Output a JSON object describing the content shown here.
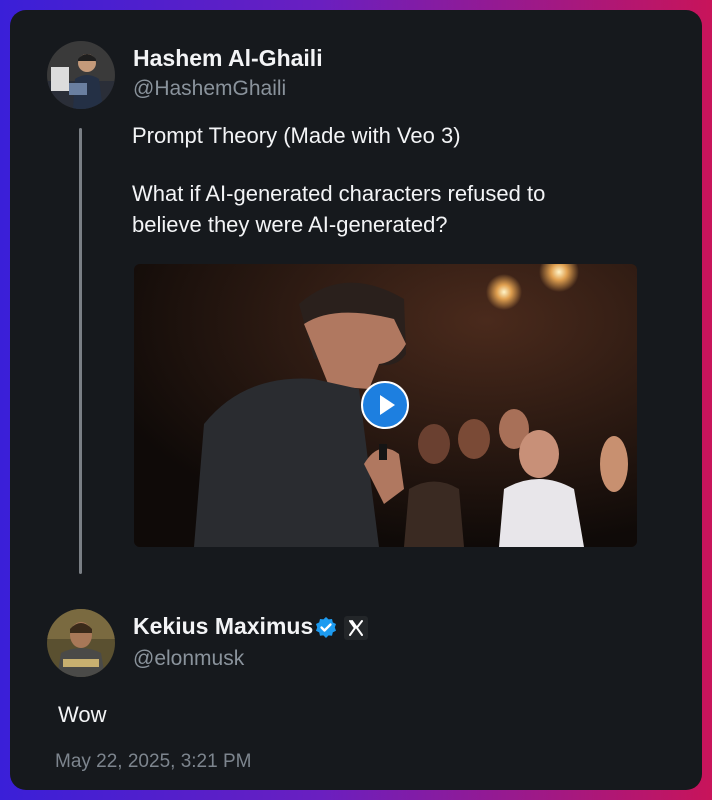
{
  "original_post": {
    "author_name": "Hashem Al-Ghaili",
    "author_handle": "@HashemGhaili",
    "line1": "Prompt Theory (Made with Veo 3)",
    "line2": "What if AI-generated characters refused to",
    "line3": "believe they were AI-generated?",
    "avatar_icon": "person-photo-avatar",
    "media_icon": "play-icon"
  },
  "reply": {
    "author_name": "Kekius Maximus",
    "author_handle": "@elonmusk",
    "verified_icon": "verified-badge-icon",
    "platform_icon": "x-logo-icon",
    "text": "Wow",
    "timestamp": "May 22, 2025, 3:21 PM"
  },
  "colors": {
    "card_bg": "#16191d",
    "verified": "#1d9bf0",
    "play_button": "#1d7fe0",
    "thread_line": "#7a7f85"
  }
}
